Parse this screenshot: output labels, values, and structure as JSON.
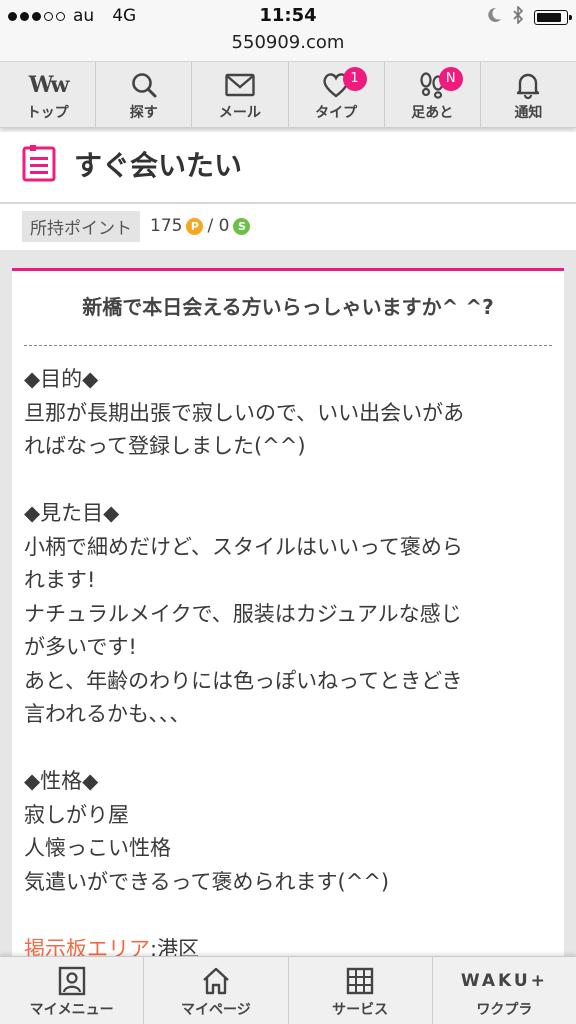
{
  "status_bar": {
    "carrier": "au",
    "network": "4G",
    "time": "11:54",
    "battery_level": 0.9
  },
  "browser": {
    "url": "550909.com"
  },
  "nav": {
    "items": [
      {
        "label": "トップ",
        "icon": "ww-logo-icon"
      },
      {
        "label": "探す",
        "icon": "search-icon"
      },
      {
        "label": "メール",
        "icon": "mail-icon"
      },
      {
        "label": "タイプ",
        "icon": "heart-icon",
        "badge": "1"
      },
      {
        "label": "足あと",
        "icon": "footprints-icon",
        "badge": "N"
      },
      {
        "label": "通知",
        "icon": "bell-icon"
      }
    ]
  },
  "page": {
    "title": "すぐ会いたい"
  },
  "points": {
    "label": "所持ポイント",
    "value": "175",
    "p_icon": "P",
    "separator": "/ 0",
    "s_icon": "S"
  },
  "post": {
    "title": "新橋で本日会える方いらっしゃいますか^ ^?",
    "body_lines": [
      "◆目的◆",
      "旦那が長期出張で寂しいので、いい出会いがあ",
      "ればなって登録しました(^^)",
      "",
      "◆見た目◆",
      "小柄で細めだけど、スタイルはいいって褒めら",
      "れます!",
      "ナチュラルメイクで、服装はカジュアルな感じ",
      "が多いです!",
      "あと、年齢のわりには色っぽいねってときどき",
      "言われるかも、、、",
      "",
      "◆性格◆",
      "寂しがり屋",
      "人懐っこい性格",
      "気遣いができるって褒められます(^^)",
      ""
    ],
    "area_label": "掲示板エリア",
    "area_value": ":港区"
  },
  "bottom_nav": {
    "items": [
      {
        "label": "マイメニュー",
        "icon": "profile-icon"
      },
      {
        "label": "マイページ",
        "icon": "home-icon"
      },
      {
        "label": "サービス",
        "icon": "grid-icon"
      },
      {
        "label": "ワクプラ",
        "icon": "waku-plus-logo",
        "logo_text": "WAKU+"
      }
    ]
  },
  "colors": {
    "accent": "#ee1c7e",
    "link": "#f36b45",
    "coin_p": "#f5a623",
    "coin_s": "#6cc04a"
  }
}
